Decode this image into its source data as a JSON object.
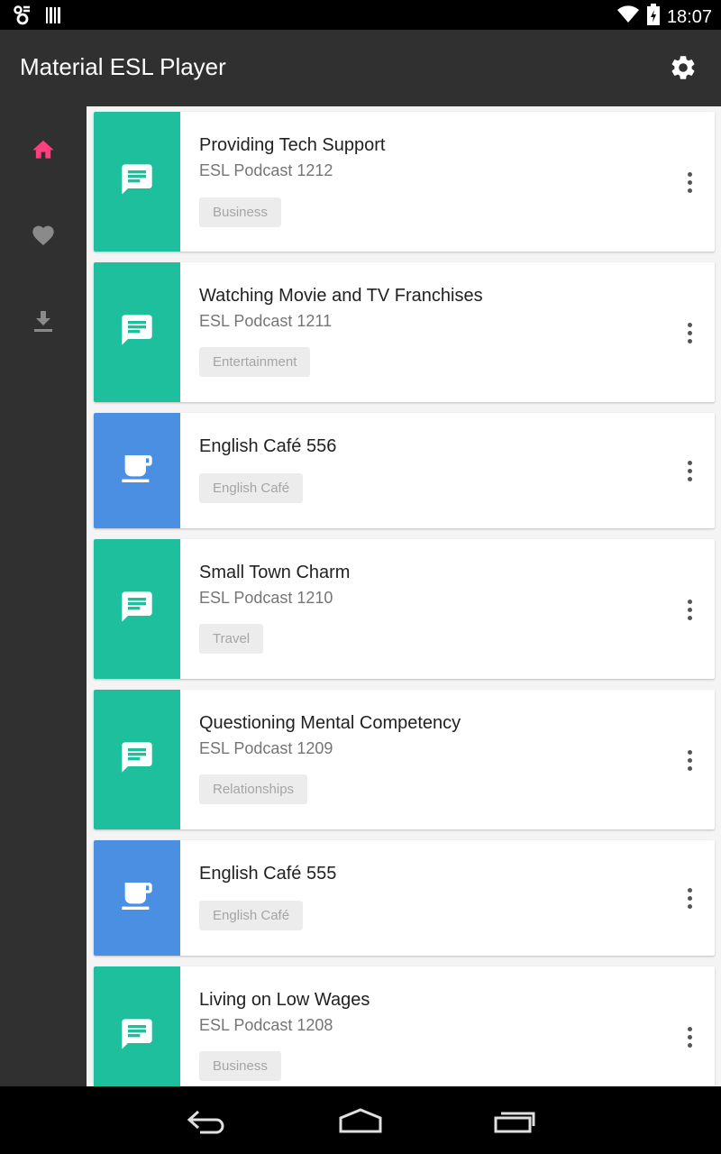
{
  "status_bar": {
    "time": "18:07",
    "icons": [
      "notification-app-icon",
      "barcode-icon",
      "wifi-icon",
      "battery-icon"
    ]
  },
  "app_bar": {
    "title": "Material ESL Player",
    "settings_icon": "gear-icon"
  },
  "rail": {
    "items": [
      {
        "icon": "home-icon",
        "active": true,
        "color": "#ff3d7f"
      },
      {
        "icon": "heart-icon",
        "active": false,
        "color": "#9e9e9e"
      },
      {
        "icon": "download-icon",
        "active": false,
        "color": "#9e9e9e"
      }
    ]
  },
  "colors": {
    "podcast_tile": "#1dbf9c",
    "cafe_tile": "#4a8fe2",
    "accent": "#ff3d7f"
  },
  "episodes": [
    {
      "title": "Providing Tech Support",
      "subtitle": "ESL Podcast 1212",
      "tag": "Business",
      "icon": "chat-bubble-icon",
      "kind": "podcast"
    },
    {
      "title": "Watching Movie and TV Franchises",
      "subtitle": "ESL Podcast 1211",
      "tag": "Entertainment",
      "icon": "chat-bubble-icon",
      "kind": "podcast"
    },
    {
      "title": "English Café 556",
      "subtitle": "",
      "tag": "English Café",
      "icon": "coffee-cup-icon",
      "kind": "cafe"
    },
    {
      "title": "Small Town Charm",
      "subtitle": "ESL Podcast 1210",
      "tag": "Travel",
      "icon": "chat-bubble-icon",
      "kind": "podcast"
    },
    {
      "title": "Questioning Mental Competency",
      "subtitle": "ESL Podcast 1209",
      "tag": "Relationships",
      "icon": "chat-bubble-icon",
      "kind": "podcast"
    },
    {
      "title": "English Café 555",
      "subtitle": "",
      "tag": "English Café",
      "icon": "coffee-cup-icon",
      "kind": "cafe"
    },
    {
      "title": "Living on Low Wages",
      "subtitle": "ESL Podcast 1208",
      "tag": "Business",
      "icon": "chat-bubble-icon",
      "kind": "podcast"
    }
  ],
  "nav_bar": {
    "buttons": [
      "back-icon",
      "home-outline-icon",
      "recents-icon"
    ]
  }
}
